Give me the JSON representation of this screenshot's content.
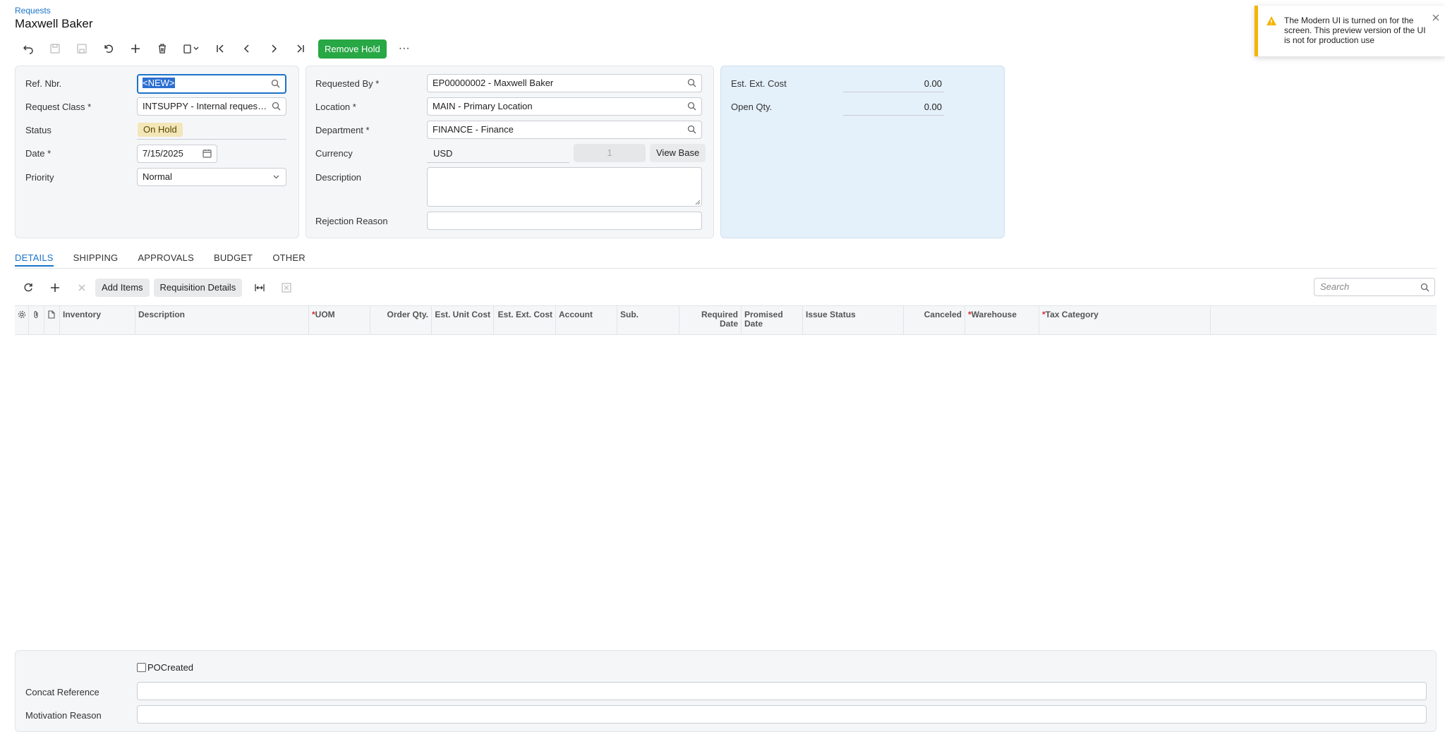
{
  "header": {
    "breadcrumb": "Requests",
    "title": "Maxwell Baker"
  },
  "toolbar": {
    "remove_hold_label": "Remove Hold",
    "more_label": "···"
  },
  "summary": {
    "ref_nbr_label": "Ref. Nbr.",
    "ref_nbr_value": "<NEW>",
    "request_class_label": "Request Class",
    "request_class_value": "INTSUPPY - Internal request f...",
    "status_label": "Status",
    "status_value": "On Hold",
    "date_label": "Date",
    "date_value": "7/15/2025",
    "priority_label": "Priority",
    "priority_value": "Normal",
    "requested_by_label": "Requested By",
    "requested_by_value": "EP00000002 - Maxwell Baker",
    "location_label": "Location",
    "location_value": "MAIN - Primary Location",
    "department_label": "Department",
    "department_value": "FINANCE - Finance",
    "currency_label": "Currency",
    "currency_value": "USD",
    "currency_rate": "1",
    "view_base_label": "View Base",
    "description_label": "Description",
    "description_value": "",
    "rejection_reason_label": "Rejection Reason",
    "rejection_reason_value": "",
    "est_ext_cost_label": "Est. Ext. Cost",
    "est_ext_cost_value": "0.00",
    "open_qty_label": "Open Qty.",
    "open_qty_value": "0.00",
    "required_mark": "*"
  },
  "tabs": [
    {
      "label": "DETAILS",
      "active": true
    },
    {
      "label": "SHIPPING",
      "active": false
    },
    {
      "label": "APPROVALS",
      "active": false
    },
    {
      "label": "BUDGET",
      "active": false
    },
    {
      "label": "OTHER",
      "active": false
    }
  ],
  "grid_toolbar": {
    "add_items_label": "Add Items",
    "requisition_details_label": "Requisition Details",
    "search_placeholder": "Search"
  },
  "grid_columns": [
    {
      "label": "Inventory",
      "required": false
    },
    {
      "label": "Description",
      "required": false
    },
    {
      "label": "UOM",
      "required": true
    },
    {
      "label": "Order Qty.",
      "required": false
    },
    {
      "label": "Est. Unit Cost",
      "required": false
    },
    {
      "label": "Est. Ext. Cost",
      "required": false
    },
    {
      "label": "Account",
      "required": false
    },
    {
      "label": "Sub.",
      "required": false
    },
    {
      "label": "Required Date",
      "required": false
    },
    {
      "label": "Promised Date",
      "required": false
    },
    {
      "label": "Issue Status",
      "required": false
    },
    {
      "label": "Canceled",
      "required": false
    },
    {
      "label": "Warehouse",
      "required": true
    },
    {
      "label": "Tax Category",
      "required": true
    }
  ],
  "footer": {
    "po_created_label": "POCreated",
    "po_created_checked": false,
    "concat_reference_label": "Concat Reference",
    "concat_reference_value": "",
    "motivation_reason_label": "Motivation Reason",
    "motivation_reason_value": ""
  },
  "toast": {
    "message": "The Modern UI is turned on for the screen. This preview version of the UI is not for production use"
  },
  "colors": {
    "accent": "#1a73c8",
    "primary_button": "#28a745",
    "warning": "#f5b400",
    "status_badge": "#f3e6b8",
    "summary_panel": "#e4f0fa"
  }
}
